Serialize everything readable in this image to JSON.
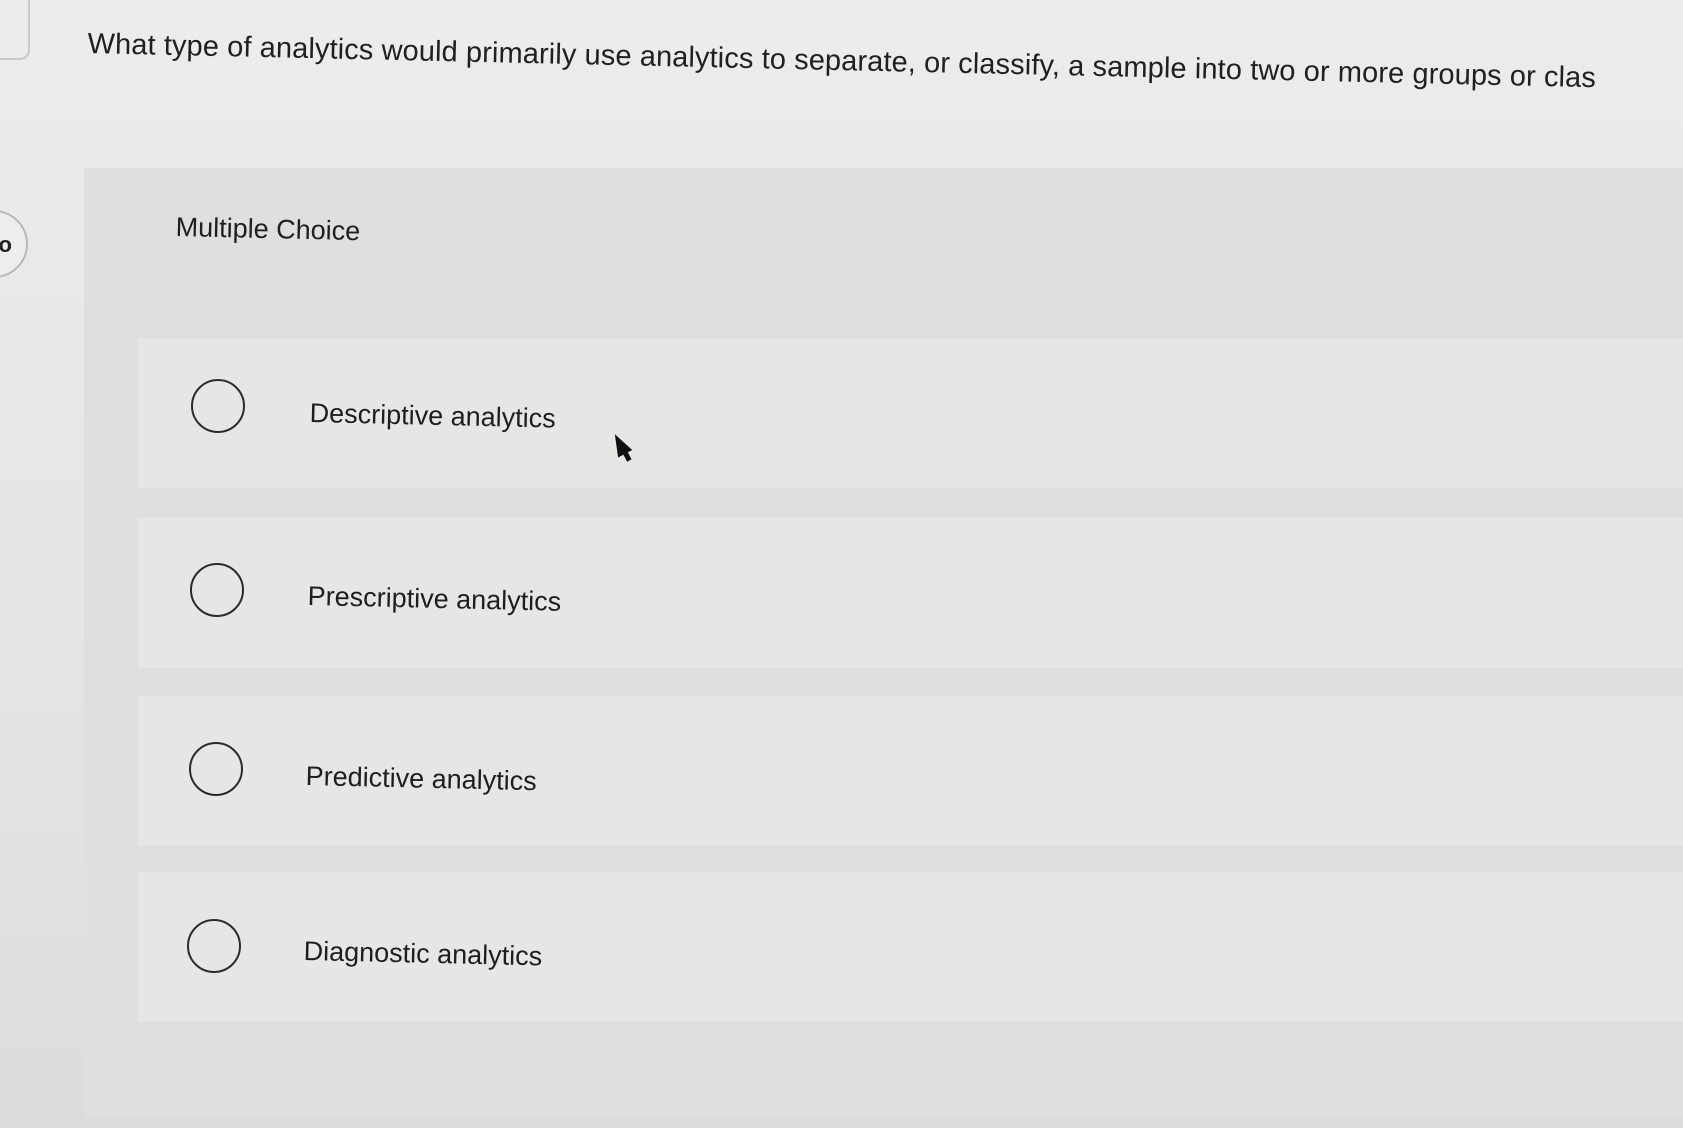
{
  "question": {
    "text": "What type of analytics would primarily use analytics to separate, or classify, a sample into two or more groups or clas"
  },
  "nav": {
    "badge_text": "o"
  },
  "panel": {
    "title": "Multiple Choice"
  },
  "options": [
    {
      "label": "Descriptive analytics",
      "selected": false
    },
    {
      "label": "Prescriptive analytics",
      "selected": false
    },
    {
      "label": "Predictive analytics",
      "selected": false
    },
    {
      "label": "Diagnostic analytics",
      "selected": false
    }
  ],
  "icons": {
    "radio": "radio-unchecked-icon",
    "cursor": "mouse-pointer-icon"
  }
}
